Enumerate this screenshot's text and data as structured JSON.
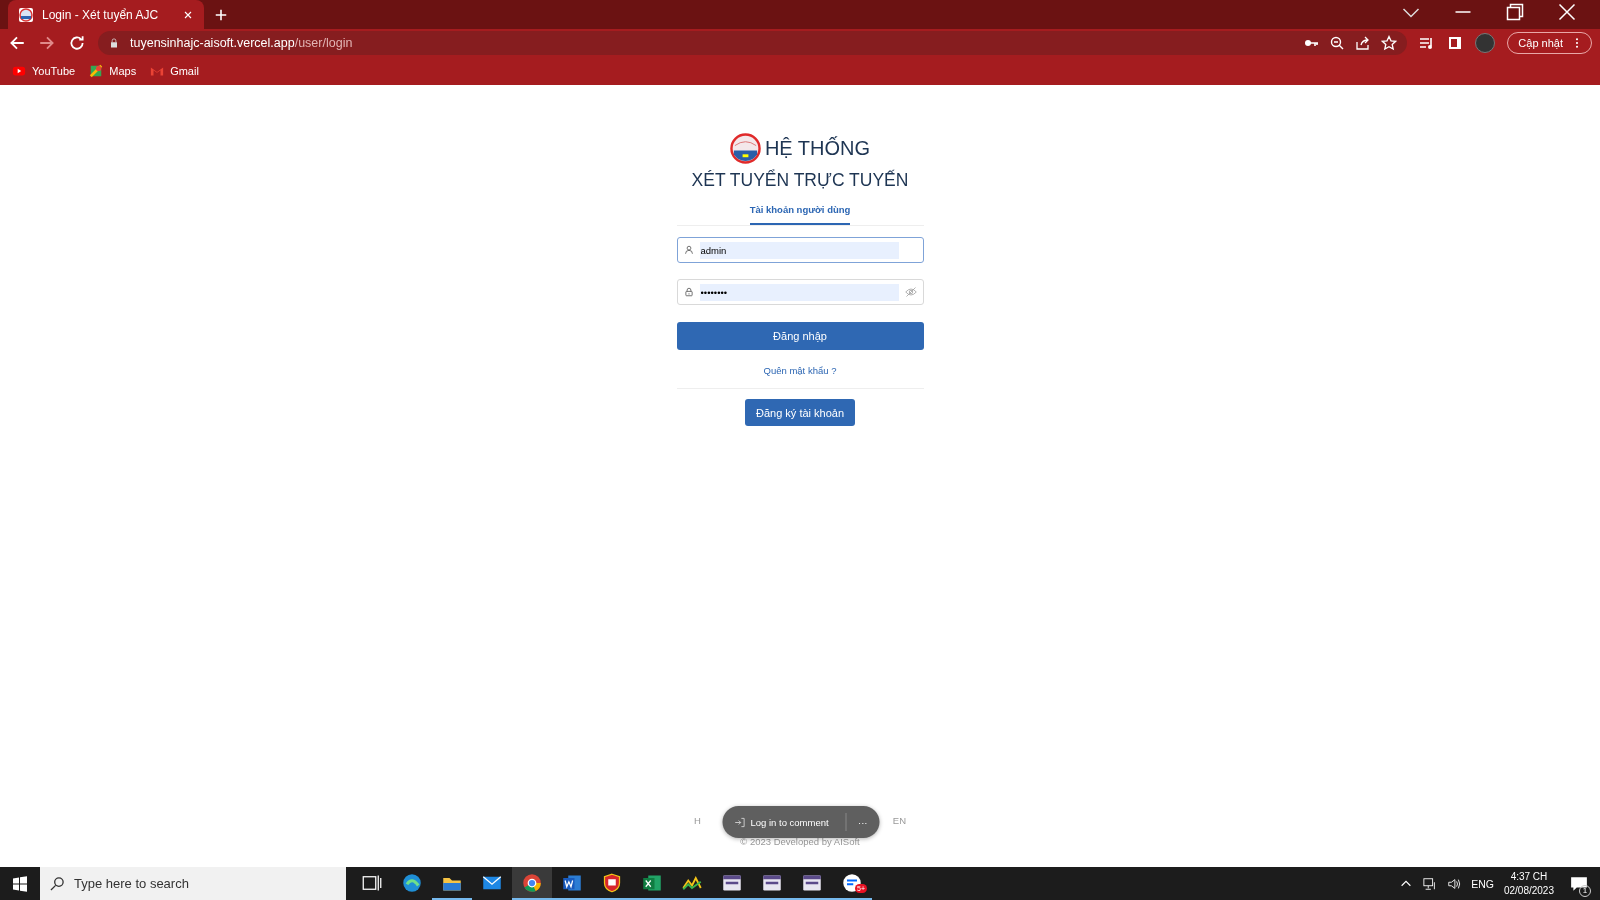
{
  "browser": {
    "tabs": [
      {
        "title": "Login - Xét tuyển AJC",
        "selected": true
      }
    ],
    "address": {
      "host": "tuyensinhajc-aisoft.vercel.app",
      "path": "/user/login"
    },
    "bookmarks": [
      {
        "label": "YouTube",
        "kind": "youtube"
      },
      {
        "label": "Maps",
        "kind": "maps"
      },
      {
        "label": "Gmail",
        "kind": "gmail"
      }
    ],
    "update_button": "Cập nhật"
  },
  "login": {
    "title_line1": "HỆ THỐNG",
    "title_line2": "XÉT TUYỂN TRỰC TUYẾN",
    "tabs": [
      {
        "label": "Tài khoản người dùng",
        "selected": true
      }
    ],
    "fields": [
      {
        "kind": "user",
        "value": "admin"
      },
      {
        "kind": "password",
        "value": "••••••••"
      }
    ],
    "submit": "Đăng nhập",
    "forgot": "Quên mật khẩu ?",
    "register": "Đăng ký tài khoản"
  },
  "footer": {
    "left_fragment": "H",
    "right_fragment": "EN",
    "copyright": "© 2023 Developed by AISoft"
  },
  "comment_pill": {
    "label": "Log in to comment",
    "more": "···"
  },
  "taskbar": {
    "search_placeholder": "Type here to search",
    "apps": [
      {
        "kind": "taskview",
        "open": false,
        "selected": false
      },
      {
        "kind": "edge",
        "open": false,
        "selected": false
      },
      {
        "kind": "folder",
        "open": true,
        "selected": false
      },
      {
        "kind": "mail",
        "open": false,
        "selected": false
      },
      {
        "kind": "chrome",
        "open": true,
        "selected": true
      },
      {
        "kind": "word",
        "open": true,
        "selected": false
      },
      {
        "kind": "shield",
        "open": true,
        "selected": false
      },
      {
        "kind": "excel",
        "open": true,
        "selected": false
      },
      {
        "kind": "chart",
        "open": true,
        "selected": false
      },
      {
        "kind": "window",
        "open": true,
        "selected": false
      },
      {
        "kind": "window",
        "open": true,
        "selected": false
      },
      {
        "kind": "window",
        "open": true,
        "selected": false
      },
      {
        "kind": "chat",
        "open": true,
        "selected": false,
        "badge": "5+"
      }
    ],
    "language": "ENG",
    "time": "4:37 CH",
    "date": "02/08/2023",
    "notifications": "1"
  }
}
